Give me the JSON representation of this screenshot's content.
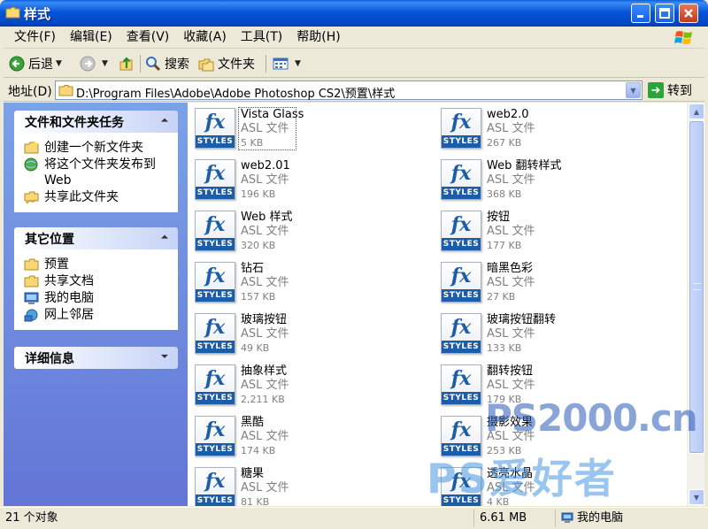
{
  "window": {
    "title": "样式"
  },
  "menu": [
    {
      "label": "文件(F)"
    },
    {
      "label": "编辑(E)"
    },
    {
      "label": "查看(V)"
    },
    {
      "label": "收藏(A)"
    },
    {
      "label": "工具(T)"
    },
    {
      "label": "帮助(H)"
    }
  ],
  "toolbar": {
    "back_label": "后退",
    "search_label": "搜索",
    "folders_label": "文件夹"
  },
  "address": {
    "label": "地址(D)",
    "path": "D:\\Program Files\\Adobe\\Adobe Photoshop CS2\\预置\\样式",
    "go_label": "转到"
  },
  "tasks": {
    "file_tasks": {
      "title": "文件和文件夹任务",
      "items": [
        {
          "label": "创建一个新文件夹"
        },
        {
          "label": "将这个文件夹发布到 Web"
        },
        {
          "label": "共享此文件夹"
        }
      ]
    },
    "other_places": {
      "title": "其它位置",
      "items": [
        {
          "label": "预置"
        },
        {
          "label": "共享文档"
        },
        {
          "label": "我的电脑"
        },
        {
          "label": "网上邻居"
        }
      ]
    },
    "details": {
      "title": "详细信息"
    }
  },
  "icon_badge": "STYLES",
  "icon_glyph": "fx",
  "files": [
    {
      "name": "Vista Glass",
      "type": "ASL 文件",
      "size": "5 KB"
    },
    {
      "name": "web2.0",
      "type": "ASL 文件",
      "size": "267 KB"
    },
    {
      "name": "web2.01",
      "type": "ASL 文件",
      "size": "196 KB"
    },
    {
      "name": "Web 翻转样式",
      "type": "ASL 文件",
      "size": "368 KB"
    },
    {
      "name": "Web 样式",
      "type": "ASL 文件",
      "size": "320 KB"
    },
    {
      "name": "按钮",
      "type": "ASL 文件",
      "size": "177 KB"
    },
    {
      "name": "钻石",
      "type": "ASL 文件",
      "size": "157 KB"
    },
    {
      "name": "暗黑色彩",
      "type": "ASL 文件",
      "size": "27 KB"
    },
    {
      "name": "玻璃按钮",
      "type": "ASL 文件",
      "size": "49 KB"
    },
    {
      "name": "玻璃按钮翻转",
      "type": "ASL 文件",
      "size": "133 KB"
    },
    {
      "name": "抽象样式",
      "type": "ASL 文件",
      "size": "2,211 KB"
    },
    {
      "name": "翻转按钮",
      "type": "ASL 文件",
      "size": "179 KB"
    },
    {
      "name": "黑酷",
      "type": "ASL 文件",
      "size": "174 KB"
    },
    {
      "name": "摄影效果",
      "type": "ASL 文件",
      "size": "253 KB"
    },
    {
      "name": "糖果",
      "type": "ASL 文件",
      "size": "81 KB"
    },
    {
      "name": "透亮水晶",
      "type": "ASL 文件",
      "size": "4 KB"
    }
  ],
  "status": {
    "count": "21 个对象",
    "size": "6.61 MB",
    "location": "我的电脑"
  },
  "watermark": {
    "logo": "PS2000.cn",
    "tagline": "PS爱好者"
  },
  "colors": {
    "titlebar": "#0555d8",
    "taskpane": "#7ba2e7",
    "fx_blue": "#1c5da8"
  }
}
